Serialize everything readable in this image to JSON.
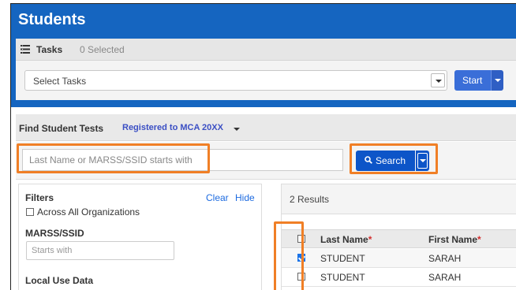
{
  "header": {
    "title": "Students"
  },
  "tasks": {
    "label": "Tasks",
    "selected_count": "0 Selected",
    "select_placeholder": "Select Tasks",
    "start_label": "Start"
  },
  "find": {
    "label": "Find Student Tests",
    "registered_filter": "Registered to MCA 20XX",
    "search_placeholder": "Last Name or MARSS/SSID starts with",
    "search_label": "Search"
  },
  "filters": {
    "title": "Filters",
    "clear_label": "Clear",
    "hide_label": "Hide",
    "across_label": "Across All Organizations",
    "marss_title": "MARSS/SSID",
    "marss_placeholder": "Starts with",
    "local_title": "Local Use Data"
  },
  "results": {
    "count": "2 Results",
    "columns": {
      "last": "Last Name",
      "first": "First Name",
      "required_mark": "*"
    },
    "rows": [
      {
        "last": "STUDENT",
        "first": "SARAH",
        "checked": true
      },
      {
        "last": "STUDENT",
        "first": "SARAH",
        "checked": false
      }
    ]
  },
  "colors": {
    "brand_blue": "#1565c0",
    "button_blue": "#0d55c8",
    "highlight_orange": "#f07f26",
    "link_blue": "#1d6be0"
  }
}
